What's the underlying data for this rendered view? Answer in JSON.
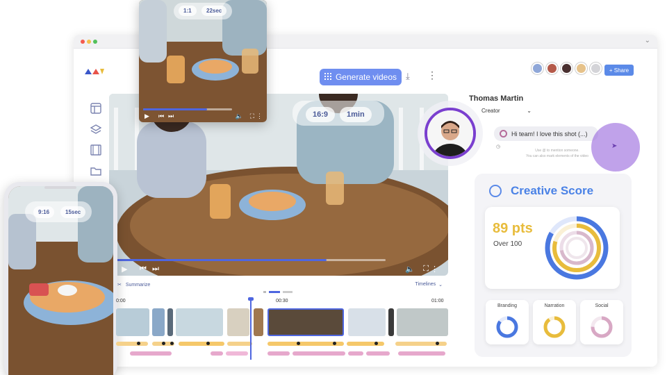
{
  "toolbar": {
    "generate_label": "Generate videos",
    "share_label": "+ Share"
  },
  "main_video": {
    "aspect": "16:9",
    "duration": "1min",
    "progress": 0.78
  },
  "float_preview": {
    "aspect": "1:1",
    "duration": "22sec",
    "progress": 0.72
  },
  "phone_preview": {
    "aspect": "9:16",
    "duration": "15sec"
  },
  "timeline": {
    "summarize_label": "Summarize",
    "timelines_label": "Timelines",
    "times": [
      "0:00",
      "00:30",
      "01:00"
    ]
  },
  "user": {
    "name": "Thomas Martin",
    "role": "Creator"
  },
  "comment": {
    "text": "Hi team! I love this shot (...)",
    "hint_line1": "Use @ to mention someone.",
    "hint_line2": "You can also mark elements of the video"
  },
  "score": {
    "title": "Creative Score",
    "points": "89 pts",
    "over": "Over 100",
    "subscores": [
      {
        "label": "Branding",
        "color": "#4a78e0",
        "value": 0.85
      },
      {
        "label": "Narration",
        "color": "#e8bc3c",
        "value": 0.9
      },
      {
        "label": "Social",
        "color": "#d8a8c4",
        "value": 0.75
      }
    ]
  },
  "colors": {
    "accent": "#6f8ef0",
    "score_blue": "#4a82e6",
    "score_yellow": "#e8bc3c",
    "purple": "#7a3fcf"
  }
}
